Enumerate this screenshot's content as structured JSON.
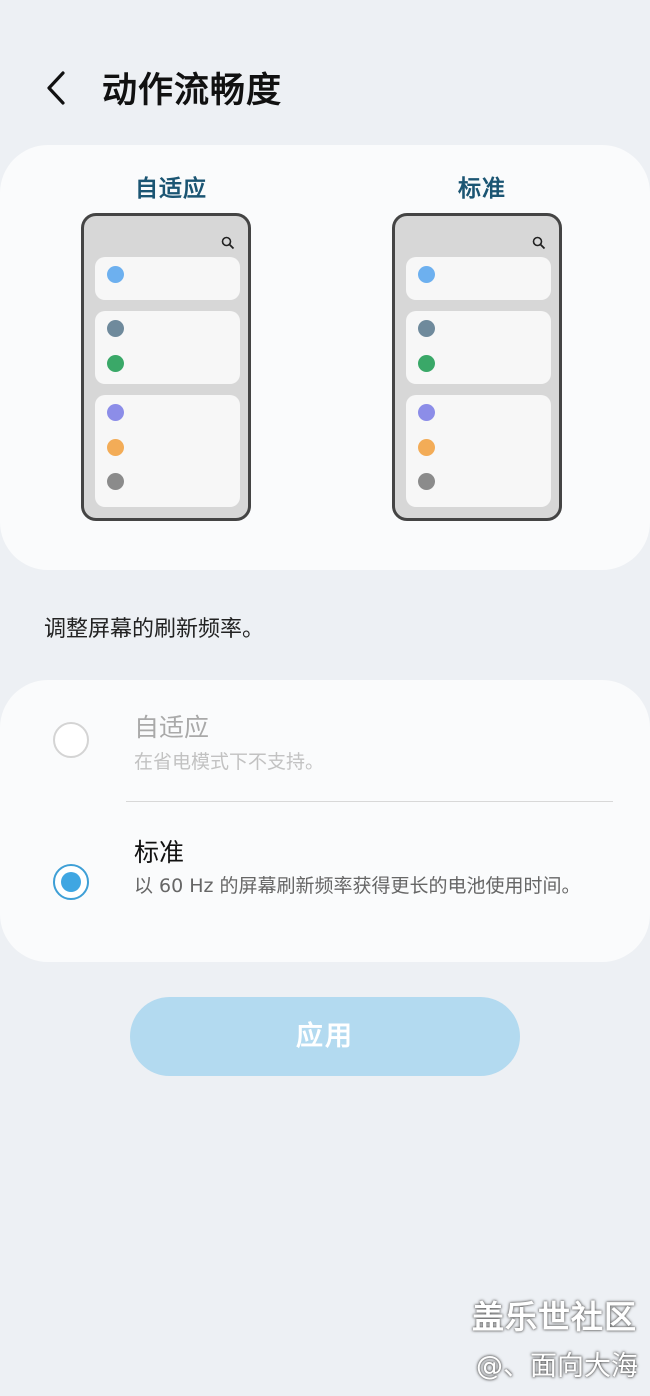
{
  "header": {
    "title": "动作流畅度"
  },
  "preview": {
    "adaptive_label": "自适应",
    "standard_label": "标准",
    "dot_colors": [
      "#6db0ef",
      "#6f8a9c",
      "#3aa868",
      "#8c8de8",
      "#f3ac57",
      "#8b8b8b"
    ]
  },
  "description": "调整屏幕的刷新频率。",
  "options": [
    {
      "title": "自适应",
      "subtitle": "在省电模式下不支持。",
      "selected": false,
      "enabled": false
    },
    {
      "title": "标准",
      "subtitle": "以 60 Hz 的屏幕刷新频率获得更长的电池使用时间。",
      "selected": true,
      "enabled": true
    }
  ],
  "apply_button": {
    "label": "应用"
  },
  "watermark": {
    "line1": "盖乐世社区",
    "line2": "@、面向大海"
  },
  "colors": {
    "accent": "#3fa6e2",
    "preview_label": "#1b5573",
    "apply_button_bg": "#b3daf0"
  }
}
